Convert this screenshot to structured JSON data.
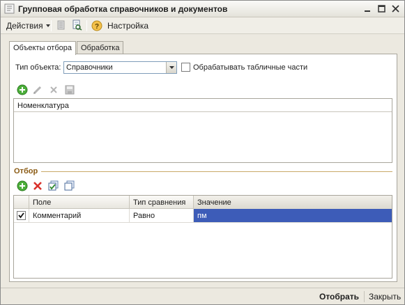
{
  "window": {
    "title": "Групповая обработка справочников и документов"
  },
  "toolbar": {
    "actions_label": "Действия",
    "settings_label": "Настройка"
  },
  "tabs": [
    {
      "label": "Объекты отбора",
      "active": true
    },
    {
      "label": "Обработка",
      "active": false
    }
  ],
  "object_type": {
    "label": "Тип объекта:",
    "value": "Справочники",
    "process_tables_label": "Обрабатывать табличные части",
    "process_tables_checked": false
  },
  "objects_list": {
    "header": "Номенклатура"
  },
  "filter": {
    "title": "Отбор",
    "columns": [
      "Поле",
      "Тип сравнения",
      "Значение"
    ],
    "rows": [
      {
        "checked": true,
        "field": "Комментарий",
        "comparison": "Равно",
        "value": "пм"
      }
    ]
  },
  "bottom": {
    "select_label": "Отобрать",
    "close_label": "Закрыть"
  },
  "colors": {
    "accent_section": "#8a5a12",
    "active_cell": "#3d5cb8"
  }
}
